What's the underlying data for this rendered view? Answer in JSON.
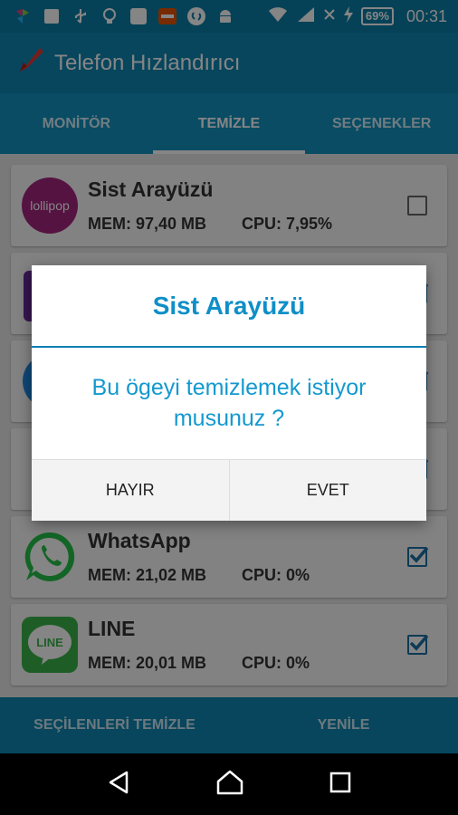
{
  "status_bar": {
    "battery": "69%",
    "time": "00:31",
    "icons": [
      "app-icon",
      "gallery-icon",
      "usb-icon",
      "bulb-icon",
      "square-app-icon",
      "news-app-icon",
      "shazam-icon",
      "android-icon",
      "wifi-icon",
      "signal-icon",
      "cross-icon",
      "charging-icon",
      "battery-icon"
    ]
  },
  "app": {
    "title": "Telefon Hızlandırıcı",
    "logo": "rocket-icon"
  },
  "tabs": [
    {
      "label": "MONİTÖR",
      "active": false
    },
    {
      "label": "TEMİZLE",
      "active": true
    },
    {
      "label": "SEÇENEKLER",
      "active": false
    }
  ],
  "processes": [
    {
      "name": "Sist Arayüzü",
      "mem": "MEM: 97,40 MB",
      "cpu": "CPU: 7,95%",
      "icon": "lollipop-icon",
      "icon_label": "lollipop",
      "checked": false
    },
    {
      "name": "",
      "mem": "",
      "cpu": "",
      "checked": true
    },
    {
      "name": "",
      "mem": "",
      "cpu": "",
      "checked": true
    },
    {
      "name": "",
      "mem": "",
      "cpu": "",
      "checked": true
    },
    {
      "name": "WhatsApp",
      "mem": "MEM: 21,02 MB",
      "cpu": "CPU: 0%",
      "icon": "whatsapp-icon",
      "checked": true
    },
    {
      "name": "LINE",
      "mem": "MEM: 20,01 MB",
      "cpu": "CPU: 0%",
      "icon": "line-icon",
      "icon_label": "LINE",
      "checked": true
    }
  ],
  "actions": {
    "clean_selected": "SEÇİLENLERİ TEMİZLE",
    "refresh": "YENİLE"
  },
  "dialog": {
    "title": "Sist Arayüzü",
    "message": "Bu ögeyi temizlemek istiyor musunuz ?",
    "cancel": "HAYIR",
    "confirm": "EVET"
  },
  "colors": {
    "primary": "#0F87B3",
    "status": "#0D7FA8",
    "accent": "#0F8FC7",
    "whatsapp": "#25C14A",
    "line": "#3BB54A"
  }
}
